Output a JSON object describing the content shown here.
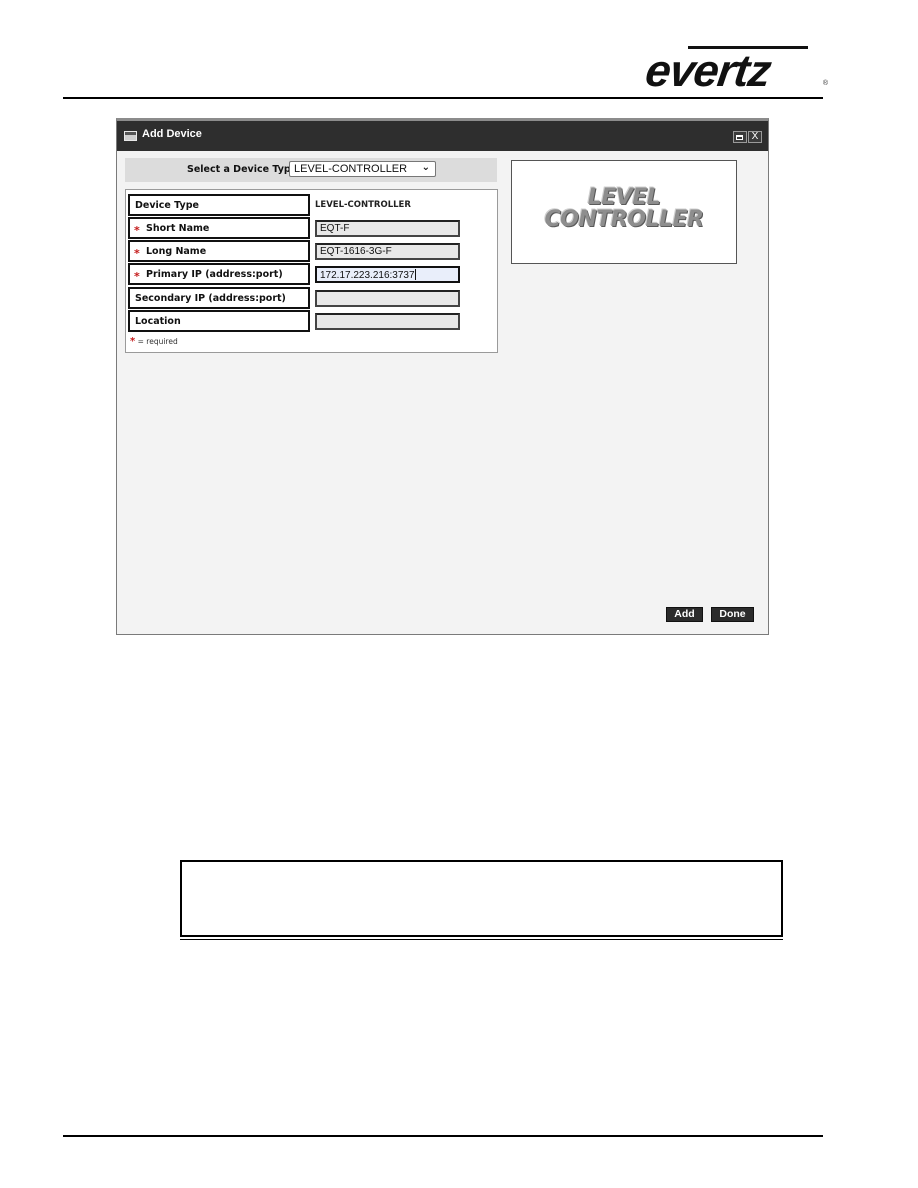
{
  "header": {
    "brand_logo_text": "evertz",
    "registered_mark": "®"
  },
  "dialog": {
    "window_icon": "window-icon",
    "title": "Add Device",
    "maximize_icon": "maximize-icon",
    "close_label": "X",
    "device_type_select": {
      "label": "Select a Device Type:",
      "selected_value": "LEVEL-CONTROLLER",
      "chevron_icon": "chevron-down-icon"
    },
    "form": {
      "rows": [
        {
          "label": "Device Type",
          "required": false,
          "value": "LEVEL-CONTROLLER",
          "editable": false
        },
        {
          "label": "Short Name",
          "required": true,
          "value": "EQT-F",
          "editable": true
        },
        {
          "label": "Long Name",
          "required": true,
          "value": "EQT-1616-3G-F",
          "editable": true
        },
        {
          "label": "Primary IP (address:port)",
          "required": true,
          "value": "172.17.223.216:3737",
          "editable": true,
          "focused": true
        },
        {
          "label": "Secondary IP (address:port)",
          "required": false,
          "value": "",
          "editable": true
        },
        {
          "label": "Location",
          "required": false,
          "value": "",
          "editable": true
        }
      ],
      "required_star": "*",
      "required_note": "= required"
    },
    "preview": {
      "line1": "LEVEL",
      "line2": "CONTROLLER"
    },
    "buttons": {
      "add": "Add",
      "done": "Done"
    }
  },
  "colors": {
    "titlebar": "#2e2e2e",
    "dialog_bg": "#f3f3f3",
    "required_star": "#c41a1a",
    "button_bg": "#2b2b2b",
    "focused_input_bg": "#e9eefa"
  }
}
